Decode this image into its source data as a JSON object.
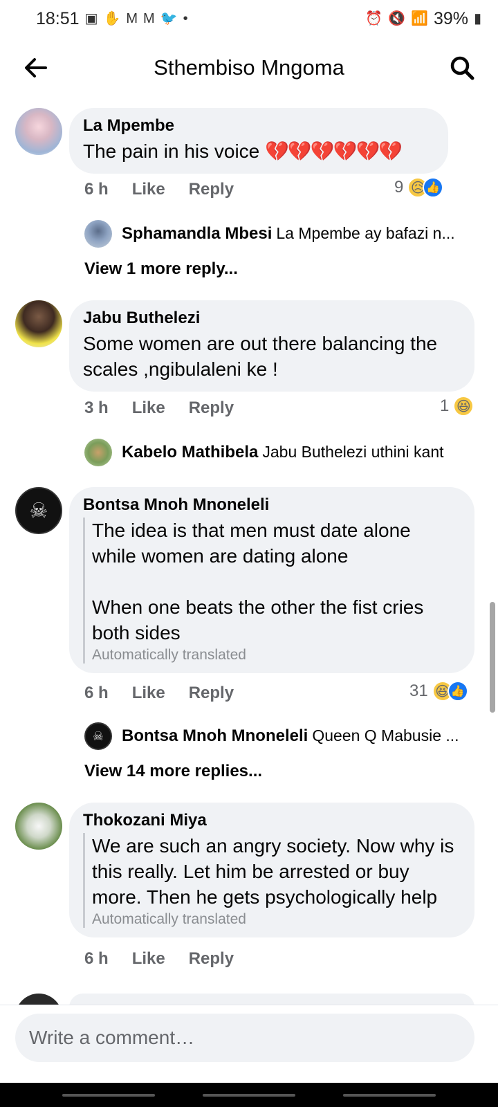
{
  "status_bar": {
    "time": "18:51",
    "left_icons": [
      "teams-icon",
      "hand-icon",
      "gmail-icon",
      "gmail-icon",
      "twitter-icon",
      "dot-icon"
    ],
    "battery": "39%"
  },
  "header": {
    "title": "Sthembiso Mngoma"
  },
  "comments": [
    {
      "author": "La Mpembe",
      "text": "The pain in his voice",
      "emoji_text": "💔💔💔💔💔💔",
      "time": "6 h",
      "like_label": "Like",
      "reply_label": "Reply",
      "reaction_count": "9",
      "subreply": {
        "author": "Sphamandla Mbesi",
        "text": "La Mpembe ay bafazi n..."
      },
      "view_more": "View 1 more reply..."
    },
    {
      "author": "Jabu Buthelezi",
      "text": "Some women are out there balancing the scales ,ngibulaleni ke !",
      "time": "3 h",
      "like_label": "Like",
      "reply_label": "Reply",
      "reaction_count": "1",
      "subreply": {
        "author": "Kabelo Mathibela",
        "text": "Jabu Buthelezi uthini kant"
      }
    },
    {
      "author": "Bontsa Mnoh Mnoneleli",
      "text_line1": "The idea is that men must date alone while women are dating alone",
      "text_line2": "When one beats the other the fist cries both sides",
      "translated_label": "Automatically translated",
      "time": "6 h",
      "like_label": "Like",
      "reply_label": "Reply",
      "reaction_count": "31",
      "subreply": {
        "author": "Bontsa Mnoh Mnoneleli",
        "text": "Queen Q Mabusie ..."
      },
      "view_more": "View 14 more replies..."
    },
    {
      "author": "Thokozani Miya",
      "text": "We are such an angry society. Now why is this really. Let him be arrested or buy more. Then he gets psychologically help",
      "translated_label": "Automatically translated",
      "time": "6 h",
      "like_label": "Like",
      "reply_label": "Reply"
    }
  ],
  "composer": {
    "placeholder": "Write a comment…"
  }
}
